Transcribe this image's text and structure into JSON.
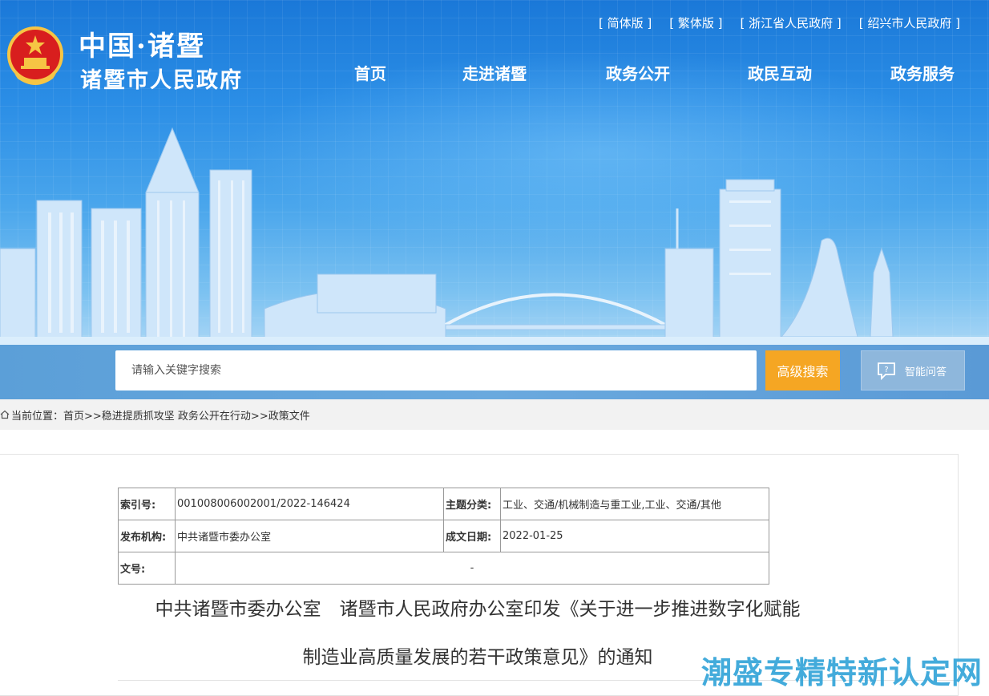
{
  "header": {
    "brand_title": "中国·诸暨",
    "brand_subtitle": "诸暨市人民政府",
    "top_links": [
      "[ 简体版 ]",
      "[ 繁体版 ]",
      "[ 浙江省人民政府 ]",
      "[ 绍兴市人民政府 ]"
    ],
    "nav": [
      "首页",
      "走进诸暨",
      "政务公开",
      "政民互动",
      "政务服务"
    ]
  },
  "search": {
    "placeholder": "请输入关键字搜索",
    "advanced_label": "高级搜索",
    "ai_label": "智能问答"
  },
  "breadcrumb": {
    "prefix": "当前位置：",
    "path": "首页>>稳进提质抓攻坚 政务公开在行动>>政策文件"
  },
  "meta": {
    "index_label": "索引号:",
    "index_value": "001008006002001/2022-146424",
    "topic_label": "主题分类:",
    "topic_value": "工业、交通/机械制造与重工业,工业、交通/其他",
    "publisher_label": "发布机构:",
    "publisher_value": "中共诸暨市委办公室",
    "date_label": "成文日期:",
    "date_value": "2022-01-25",
    "docno_label": "文号:",
    "docno_value": "-"
  },
  "article": {
    "title_line1": "中共诸暨市委办公室　诸暨市人民政府办公室印发《关于进一步推进数字化赋能",
    "title_line2": "制造业高质量发展的若干政策意见》的通知"
  },
  "watermark": "潮盛专精特新认定网",
  "colors": {
    "accent_orange": "#f5a623",
    "banner_blue": "#2b8ee6",
    "watermark_blue": "#2fa3d8"
  }
}
